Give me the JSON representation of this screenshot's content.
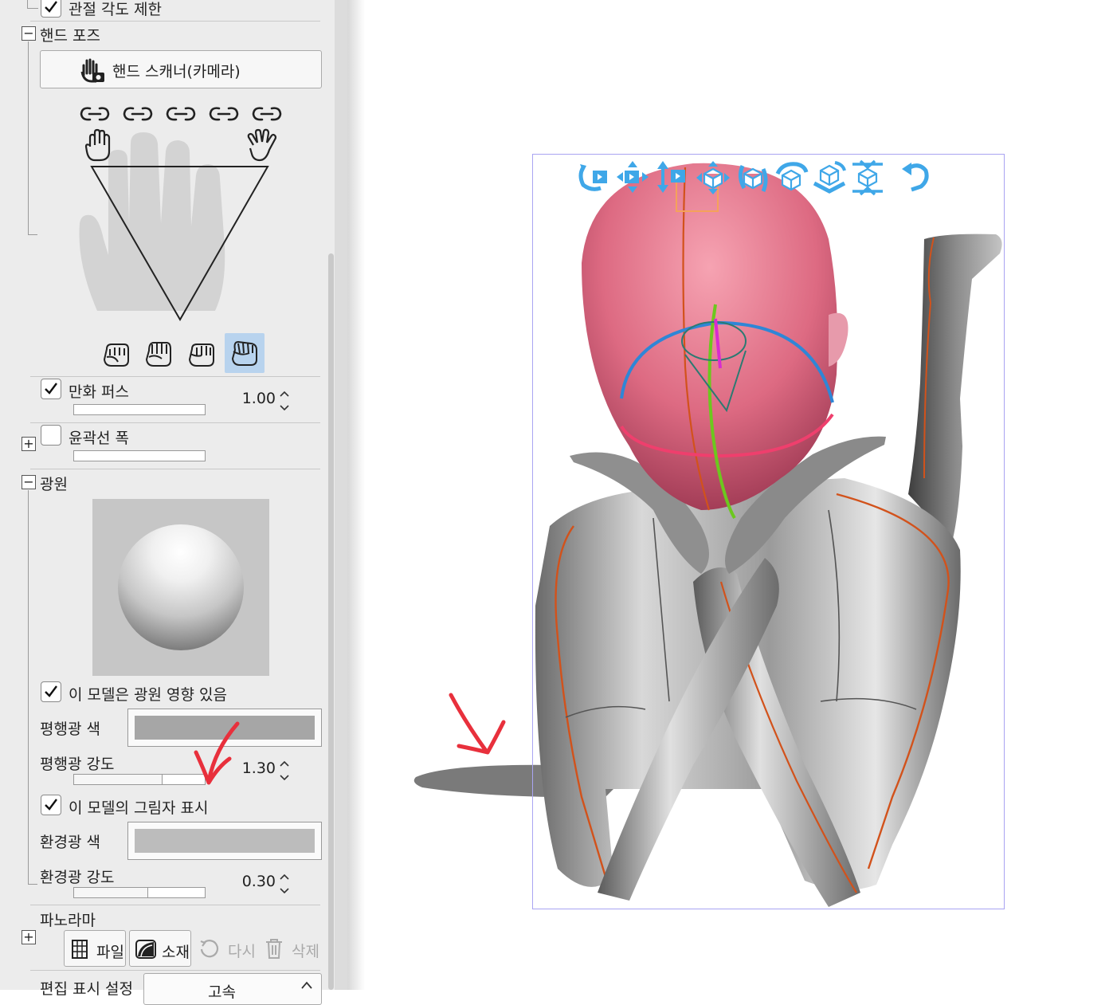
{
  "panel": {
    "joint_limit": {
      "label": "관절 각도 제한",
      "checked": true
    },
    "hand_pose": {
      "section_label": "핸드 포즈",
      "scanner_button": "핸드 스캐너(카메라)",
      "lock_icons": [
        "link-icon",
        "link-icon",
        "link-icon",
        "link-icon",
        "link-icon"
      ],
      "presets": [
        "fist-preset-1",
        "fist-preset-2",
        "fist-preset-3",
        "fist-preset-4"
      ],
      "selected_preset": 4
    },
    "manga_perspective": {
      "label": "만화 퍼스",
      "checked": true,
      "value": "1.00",
      "slider_fraction": 0.0
    },
    "outline_width": {
      "label": "윤곽선 폭",
      "checked": false,
      "slider_fraction": 0.0
    },
    "light_source": {
      "section_label": "광원",
      "affected_label": "이 모델은 광원 영향 있음",
      "affected_checked": true,
      "parallel_color_label": "평행광 색",
      "parallel_color": "#a6a6a6",
      "parallel_intensity_label": "평행광 강도",
      "parallel_intensity_value": "1.30",
      "parallel_intensity_fraction": 0.67,
      "shadow_label": "이 모델의 그림자 표시",
      "shadow_checked": true,
      "ambient_color_label": "환경광 색",
      "ambient_color": "#bcbcbc",
      "ambient_intensity_label": "환경광 강도",
      "ambient_intensity_value": "0.30",
      "ambient_intensity_fraction": 0.56
    },
    "panorama": {
      "section_label": "파노라마",
      "buttons": [
        {
          "label": "파일",
          "icon": "file-icon",
          "enabled": true
        },
        {
          "label": "소재",
          "icon": "material-icon",
          "enabled": true
        },
        {
          "label": "다시",
          "icon": "reset-icon",
          "enabled": false
        },
        {
          "label": "삭제",
          "icon": "trash-icon",
          "enabled": false
        }
      ]
    },
    "edit_display": {
      "label": "편집 표시 설정",
      "value": "고속"
    }
  },
  "canvas": {
    "toolbar_icons": [
      "rotate-camera-icon",
      "pan-camera-icon",
      "dolly-camera-icon",
      "move-object-icon",
      "rotate-object-icon",
      "rotate-object-y-icon",
      "rotate-object-plane-icon",
      "snap-object-icon",
      "reset-icon"
    ],
    "accent": "#3fa7e8",
    "selection_color": "#a9a4f2",
    "annotation_color": "#e8303c"
  }
}
